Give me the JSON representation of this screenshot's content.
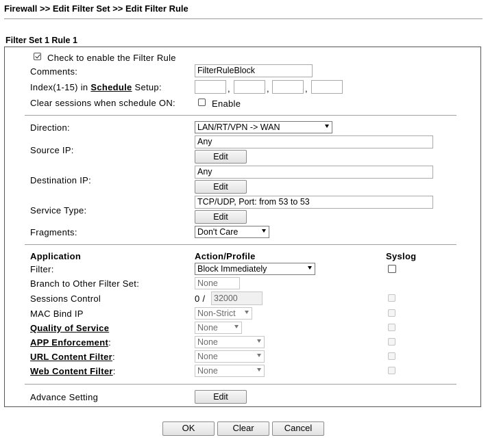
{
  "breadcrumb": "Firewall >> Edit Filter Set >> Edit Filter Rule",
  "set_title": "Filter Set 1 Rule 1",
  "enable": {
    "label": "Check to enable the Filter Rule",
    "checked": true
  },
  "comments": {
    "label": "Comments:",
    "value": "FilterRuleBlock"
  },
  "schedule": {
    "prefix": "Index(1-15) in",
    "link": "Schedule",
    "suffix": "Setup:",
    "sep": ","
  },
  "clear_sessions": {
    "label": "Clear sessions when schedule ON:",
    "option": "Enable"
  },
  "direction": {
    "label": "Direction:",
    "value": "LAN/RT/VPN -> WAN"
  },
  "source_ip": {
    "label": "Source IP:",
    "value": "Any",
    "edit": "Edit"
  },
  "destination_ip": {
    "label": "Destination IP:",
    "value": "Any",
    "edit": "Edit"
  },
  "service_type": {
    "label": "Service Type:",
    "value": "TCP/UDP, Port: from 53 to 53",
    "edit": "Edit"
  },
  "fragments": {
    "label": "Fragments:",
    "value": "Don't Care"
  },
  "columns": {
    "application": "Application",
    "action": "Action/Profile",
    "syslog": "Syslog"
  },
  "filter": {
    "label": "Filter:",
    "value": "Block Immediately"
  },
  "branch": {
    "label": "Branch to Other Filter Set:",
    "value": "None"
  },
  "sessions_control": {
    "label": "Sessions Control",
    "current": "0",
    "slash": "/",
    "max": "32000"
  },
  "mac_bind": {
    "label": "MAC Bind IP",
    "value": "Non-Strict"
  },
  "qos": {
    "label": "Quality of Service",
    "value": "None"
  },
  "app_enforcement": {
    "label": "APP Enforcement",
    "colon": ":",
    "value": "None"
  },
  "url_filter": {
    "label": "URL Content Filter",
    "colon": ":",
    "value": "None"
  },
  "web_filter": {
    "label": "Web Content Filter",
    "colon": ":",
    "value": "None"
  },
  "advance": {
    "label": "Advance Setting",
    "edit": "Edit"
  },
  "buttons": {
    "ok": "OK",
    "clear": "Clear",
    "cancel": "Cancel"
  }
}
